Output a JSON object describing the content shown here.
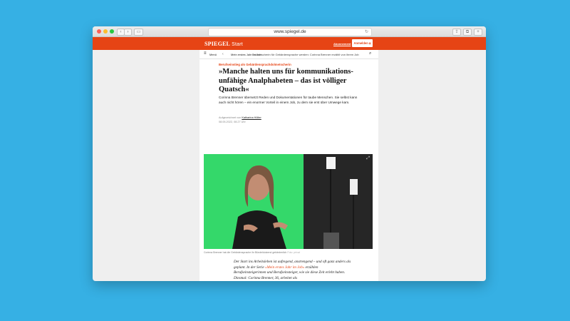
{
  "browser": {
    "url": "www.spiegel.de"
  },
  "header": {
    "logo": "SPIEGEL",
    "logo_suffix": "Start",
    "abo_label": "Abonnement",
    "login_label": "Anmelden"
  },
  "navbar": {
    "menu_label": "Menü",
    "crumb_home": "‹",
    "crumb_section": "Mein erstes Jahr im Job",
    "crumb_title": "Dolmetscherin für Gebärdensprache werden: Corinna Brenner erzählt von ihrem Job"
  },
  "article": {
    "kicker": "Berufseinstieg als Gebärdensprachdolmetscherin",
    "headline": "»Manche halten uns für kommunikations­unfähige Analphabeten – das ist völliger Quatsch«",
    "teaser": "Corinna Brenner übersetzt Reden und Dokumentationen für taube Menschen. Sie selbst kann auch nicht hören – ein enormer Vorteil in einem Job, zu dem sie erst über Umwege kam.",
    "byline_prefix": "Aufgezeichnet von",
    "author": "Katharina Hölter",
    "date": "08.05.2022, 08.27 Uhr",
    "caption": "Corinna Brenner hat die Gebärdensprache ihr Bündeldutzend gebärdenlich",
    "caption_credit": "Foto: privat",
    "body_intro": "Der Start ins Arbeitsleben ist aufregend, anstrengend – und oft ganz anders als geplant. In der Serie",
    "body_link": "»Mein erstes Jahr im Job«",
    "body_rest": "erzählen Berufseinsteigerinnen und Berufseinsteiger, wie sie diese Zeit erlebt haben. Diesmal: Corinna Brenner, 36, arbeitet als"
  },
  "colors": {
    "brand": "#e64415",
    "background": "#36b0e4",
    "greenscreen": "#34d86a"
  }
}
